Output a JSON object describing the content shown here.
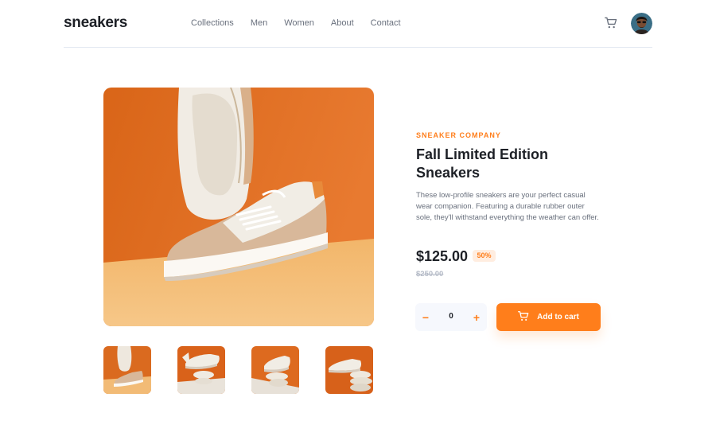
{
  "header": {
    "logo": "sneakers",
    "nav": [
      "Collections",
      "Men",
      "Women",
      "About",
      "Contact"
    ],
    "cart_icon": "cart-icon",
    "avatar_icon": "user-avatar"
  },
  "product": {
    "company": "SNEAKER COMPANY",
    "title": "Fall Limited Edition Sneakers",
    "description": "These low-profile sneakers are your perfect casual wear companion. Featuring a durable rubber outer sole, they'll withstand everything the weather can offer.",
    "price": "$125.00",
    "discount": "50%",
    "old_price": "$250.00"
  },
  "cart": {
    "minus": "−",
    "quantity": "0",
    "plus": "+",
    "add_label": "Add to cart"
  },
  "colors": {
    "accent": "#ff7e1b",
    "accent_pale": "#ffede0",
    "text_dark": "#1d2026",
    "text_gray": "#69707d"
  }
}
